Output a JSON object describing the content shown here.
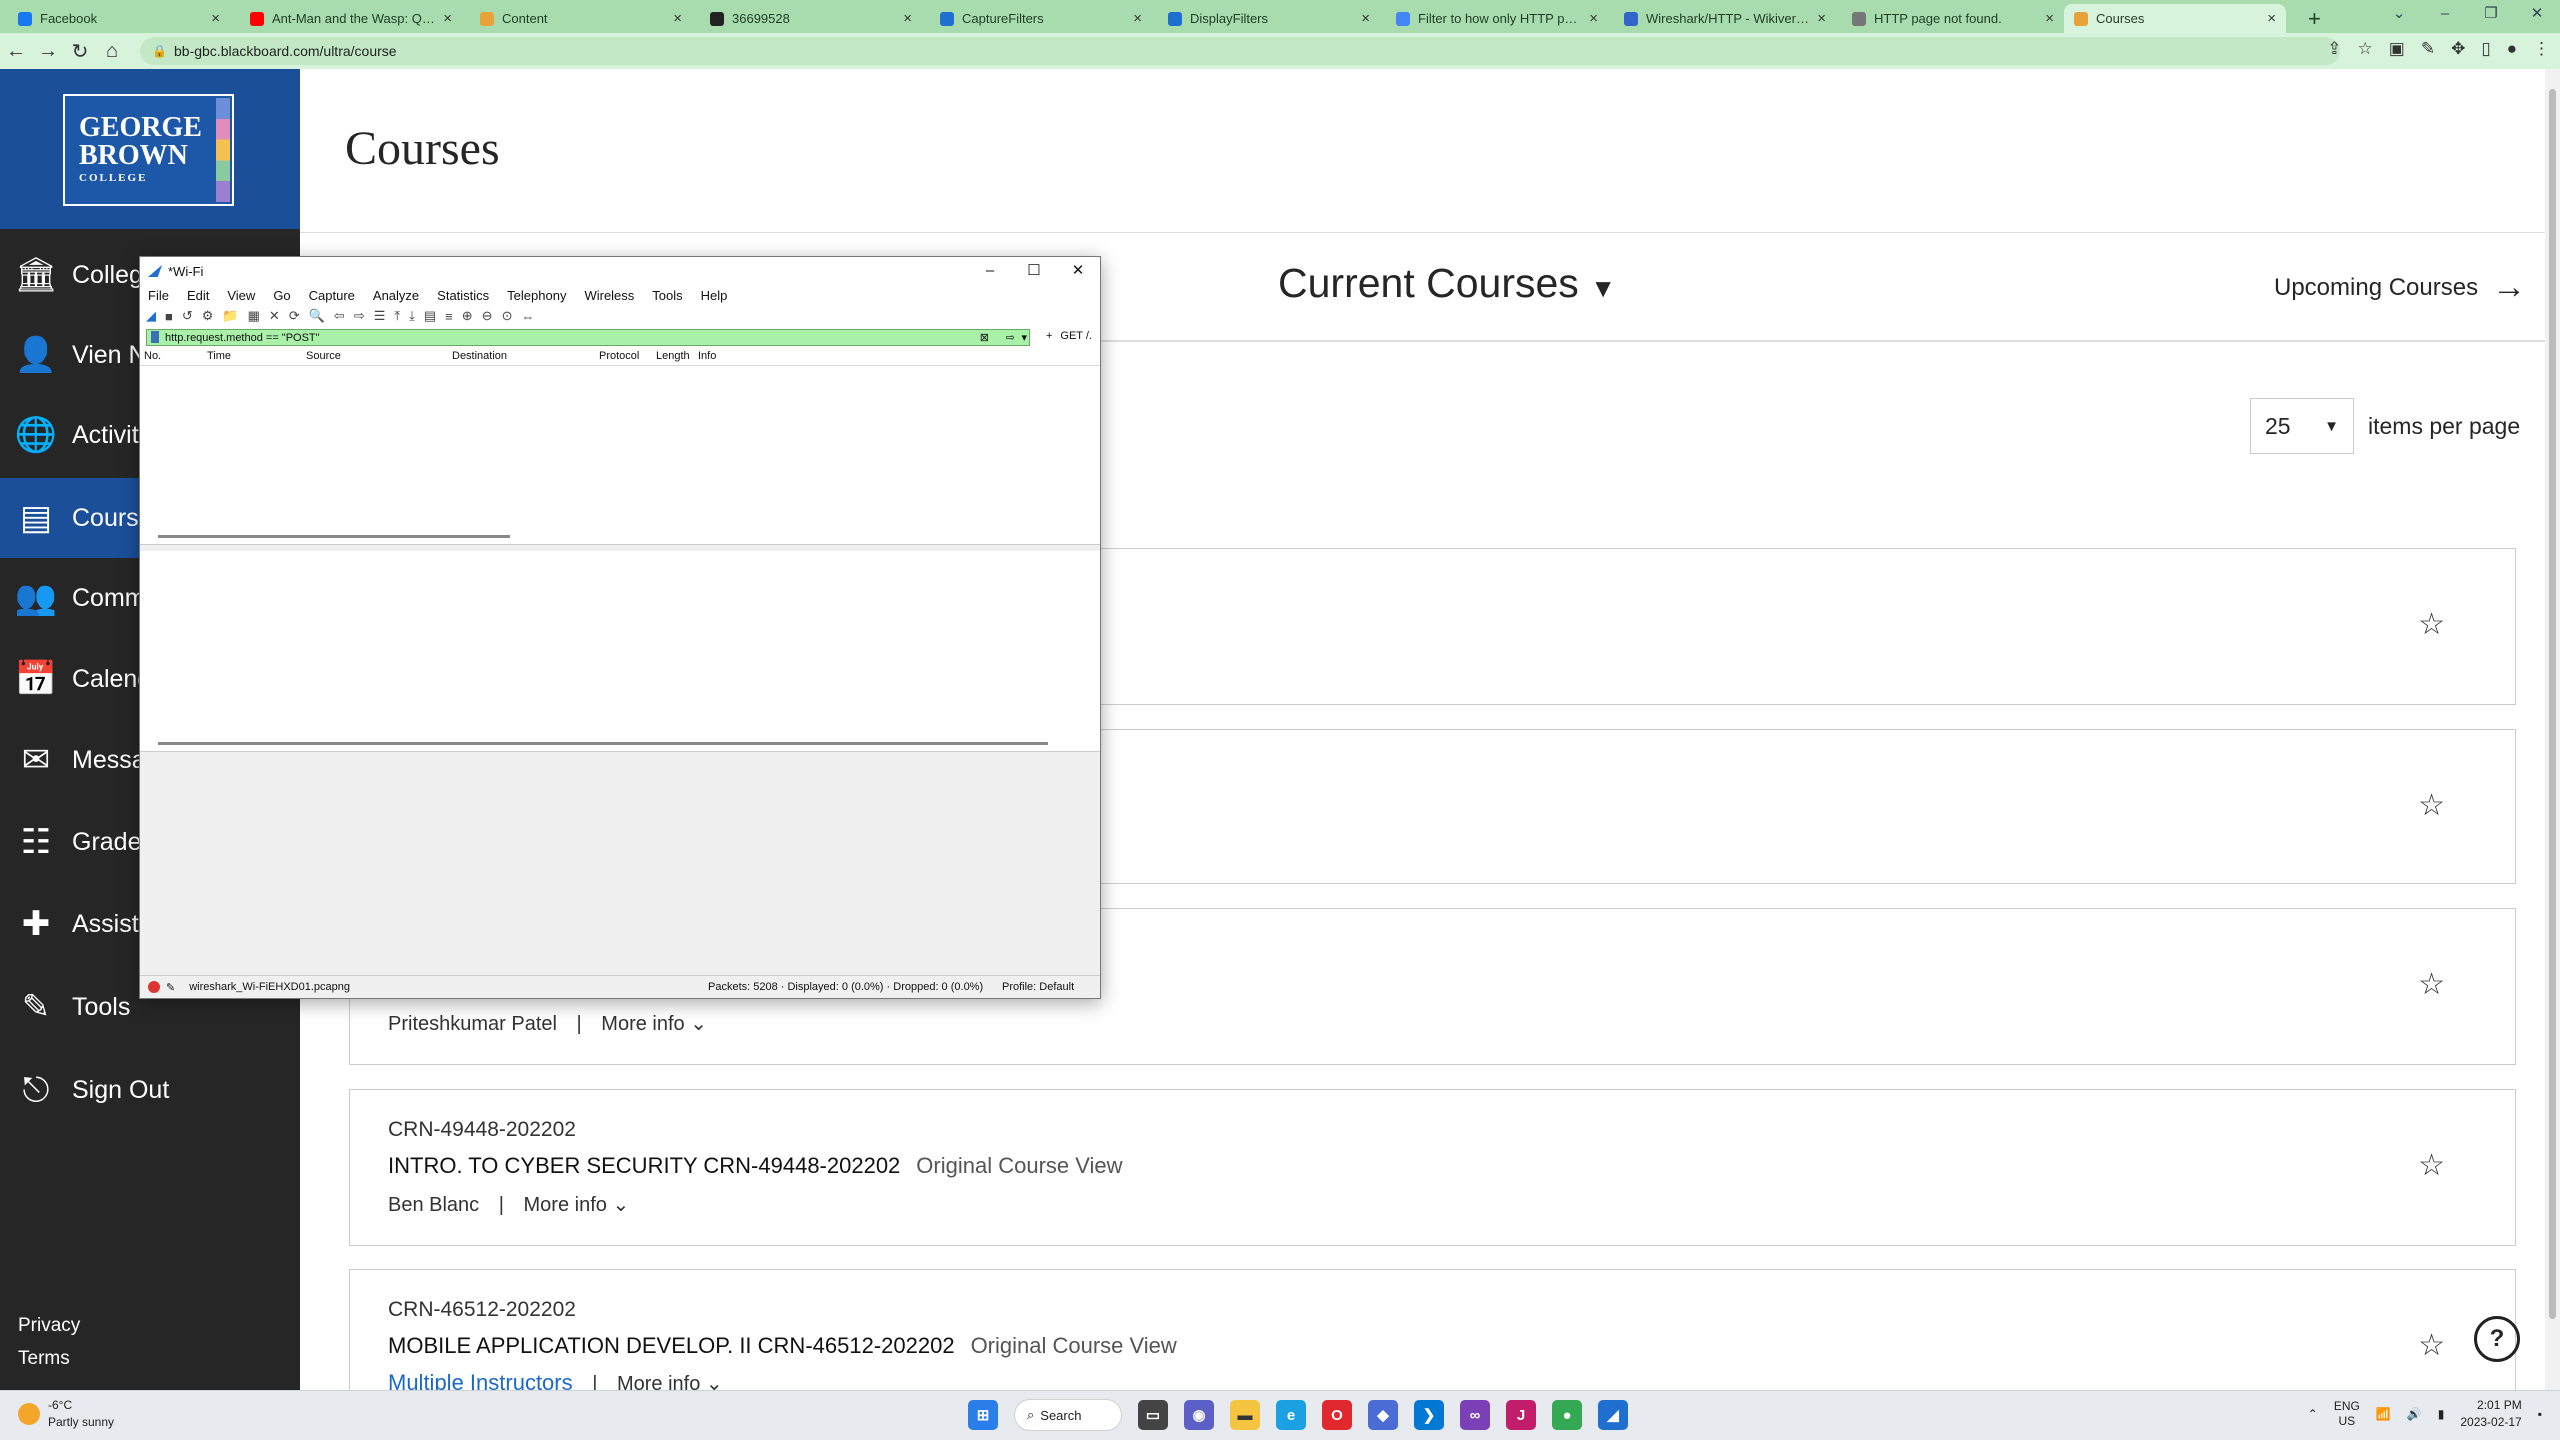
{
  "browser": {
    "tabs": [
      {
        "label": "Facebook",
        "color": "#1877f2"
      },
      {
        "label": "Ant-Man and the Wasp: Quant",
        "color": "#ff0000"
      },
      {
        "label": "Content",
        "color": "#e8a23a"
      },
      {
        "label": "36699528",
        "color": "#222222"
      },
      {
        "label": "CaptureFilters",
        "color": "#1f6fd1"
      },
      {
        "label": "DisplayFilters",
        "color": "#1f6fd1"
      },
      {
        "label": "Filter to how only HTTP post m",
        "color": "#4285f4"
      },
      {
        "label": "Wireshark/HTTP - Wikiversity",
        "color": "#3366cc"
      },
      {
        "label": "HTTP page not found.",
        "color": "#777777"
      },
      {
        "label": "Courses",
        "color": "#e8a23a"
      }
    ],
    "new_tab": "+",
    "url": "bb-gbc.blackboard.com/ultra/course"
  },
  "sidenav": {
    "logo_lines": [
      "GEORGE",
      "BROWN",
      "COLLEGE"
    ],
    "items": [
      {
        "label": "College",
        "icon": "institution-icon"
      },
      {
        "label": "Vien N",
        "icon": "user-icon"
      },
      {
        "label": "Activity",
        "icon": "globe-icon"
      },
      {
        "label": "Courses",
        "icon": "courses-icon"
      },
      {
        "label": "Comm",
        "icon": "community-icon"
      },
      {
        "label": "Calend",
        "icon": "calendar-icon"
      },
      {
        "label": "Messag",
        "icon": "mail-icon"
      },
      {
        "label": "Grades",
        "icon": "grades-icon"
      },
      {
        "label": "Assist",
        "icon": "assist-icon"
      },
      {
        "label": "Tools",
        "icon": "tools-icon"
      },
      {
        "label": "Sign Out",
        "icon": "sign-out-icon"
      }
    ],
    "privacy": "Privacy",
    "terms": "Terms"
  },
  "main": {
    "title": "Courses",
    "current_courses": "Current Courses",
    "upcoming_courses": "Upcoming Courses",
    "per_page_value": "25",
    "per_page_label": "items per page",
    "cards": [
      {
        "instructor": "Priteshkumar Patel",
        "more_info": "More info"
      },
      {
        "crn": "CRN-49448-202202",
        "name": "INTRO. TO CYBER SECURITY CRN-49448-202202",
        "view": "Original Course View",
        "instructor": "Ben Blanc",
        "more_info": "More info"
      },
      {
        "crn": "CRN-46512-202202",
        "name": "MOBILE APPLICATION DEVELOP. II CRN-46512-202202",
        "view": "Original Course View",
        "instructor": "Multiple Instructors",
        "more_info": "More info"
      }
    ],
    "help": "?"
  },
  "wireshark": {
    "title": "*Wi-Fi",
    "menu": [
      "File",
      "Edit",
      "View",
      "Go",
      "Capture",
      "Analyze",
      "Statistics",
      "Telephony",
      "Wireless",
      "Tools",
      "Help"
    ],
    "filter": "http.request.method == \"POST\"",
    "filter_right": "GET /.",
    "columns": [
      "No.",
      "Time",
      "Source",
      "Destination",
      "Protocol",
      "Length",
      "Info"
    ],
    "status_file": "wireshark_Wi-FiEHXD01.pcapng",
    "status_packets": "Packets: 5208 · Displayed: 0 (0.0%) · Dropped: 0 (0.0%)",
    "status_profile": "Profile: Default"
  },
  "taskbar": {
    "temp": "-6°C",
    "weather": "Partly sunny",
    "search": "Search",
    "lang1": "ENG",
    "lang2": "US",
    "time": "2:01 PM",
    "date": "2023-02-17"
  }
}
